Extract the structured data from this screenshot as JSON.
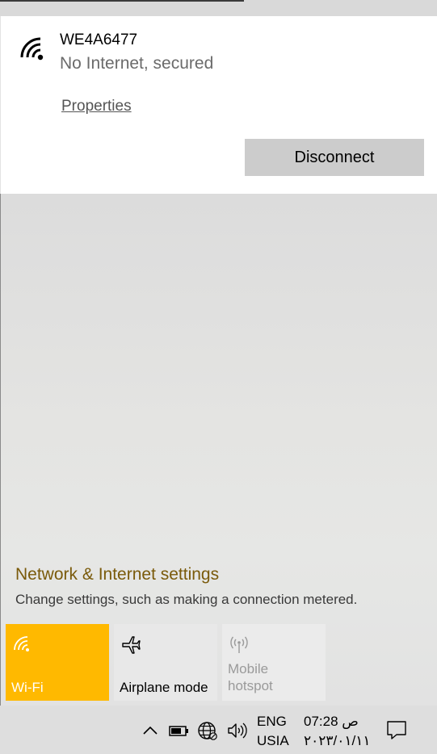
{
  "network": {
    "ssid": "WE4A6477",
    "status": "No Internet, secured",
    "properties_label": "Properties",
    "disconnect_label": "Disconnect"
  },
  "settings": {
    "title": "Network & Internet settings",
    "description": "Change settings, such as making a connection metered."
  },
  "tiles": [
    {
      "label": "Wi-Fi",
      "icon": "wifi-icon",
      "state": "on"
    },
    {
      "label": "Airplane mode",
      "icon": "airplane-icon",
      "state": "off"
    },
    {
      "label": "Mobile hotspot",
      "label_line1": "Mobile",
      "label_line2": "hotspot",
      "icon": "hotspot-icon",
      "state": "disabled"
    }
  ],
  "taskbar": {
    "language": "ENG",
    "region": "USIA",
    "time": "07:28 ص",
    "date": "٢٠٢٣/٠١/١١"
  },
  "colors": {
    "accent": "#ffb900",
    "settings_link": "#7a5a0a",
    "button_bg": "#cccccc"
  }
}
